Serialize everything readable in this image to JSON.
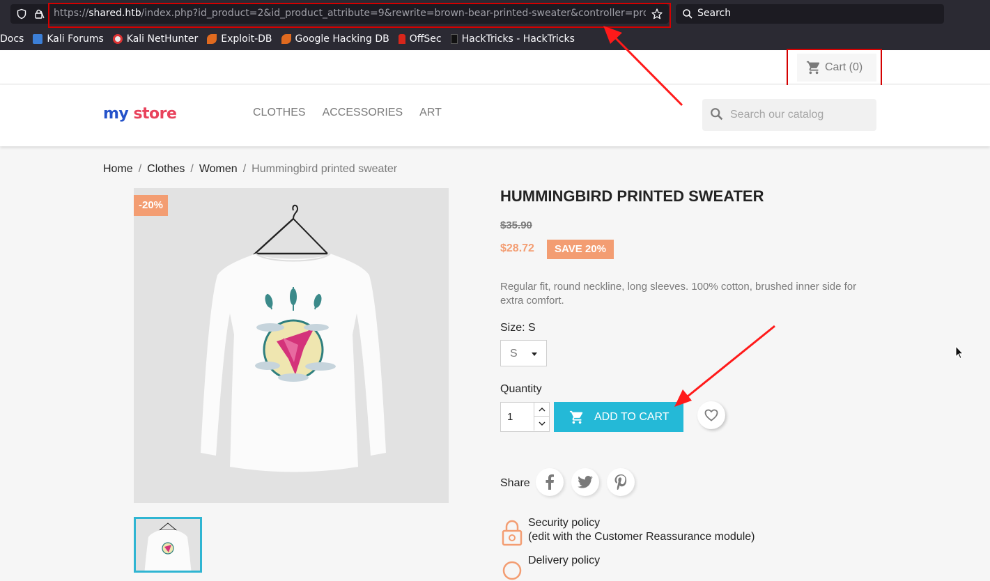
{
  "browser": {
    "url_scheme": "https://",
    "url_host": "shared.htb",
    "url_rest": "/index.php?id_product=2&id_product_attribute=9&rewrite=brown-bear-printed-sweater&controller=product",
    "search_placeholder": "Search",
    "bookmarks": [
      {
        "label": "Docs",
        "icon": "docs-icon"
      },
      {
        "label": "Kali Forums",
        "icon": "kali-forums-icon"
      },
      {
        "label": "Kali NetHunter",
        "icon": "kali-nethunter-icon"
      },
      {
        "label": "Exploit-DB",
        "icon": "exploit-db-icon"
      },
      {
        "label": "Google Hacking DB",
        "icon": "ghdb-icon"
      },
      {
        "label": "OffSec",
        "icon": "offsec-icon"
      },
      {
        "label": "HackTricks - HackTricks",
        "icon": "hacktricks-icon"
      }
    ]
  },
  "store": {
    "cart_label": "Cart (0)",
    "logo_my": "my",
    "logo_store": "store",
    "nav": [
      "CLOTHES",
      "ACCESSORIES",
      "ART"
    ],
    "search_placeholder": "Search our catalog",
    "breadcrumb": [
      "Home",
      "Clothes",
      "Women",
      "Hummingbird printed sweater"
    ]
  },
  "product": {
    "discount_badge": "-20%",
    "title": "HUMMINGBIRD PRINTED SWEATER",
    "old_price": "$35.90",
    "price": "$28.72",
    "save_label": "SAVE 20%",
    "description": "Regular fit, round neckline, long sleeves. 100% cotton, brushed inner side for extra comfort.",
    "size_label": "Size: S",
    "size_value": "S",
    "quantity_label": "Quantity",
    "quantity_value": "1",
    "add_to_cart": "ADD TO CART",
    "share_label": "Share",
    "reassurance": [
      {
        "title": "Security policy",
        "subtitle": "(edit with the Customer Reassurance module)"
      },
      {
        "title": "Delivery policy",
        "subtitle": ""
      }
    ]
  },
  "colors": {
    "accent": "#24b9d7",
    "discount": "#f39d72",
    "annotation": "#d40000"
  }
}
